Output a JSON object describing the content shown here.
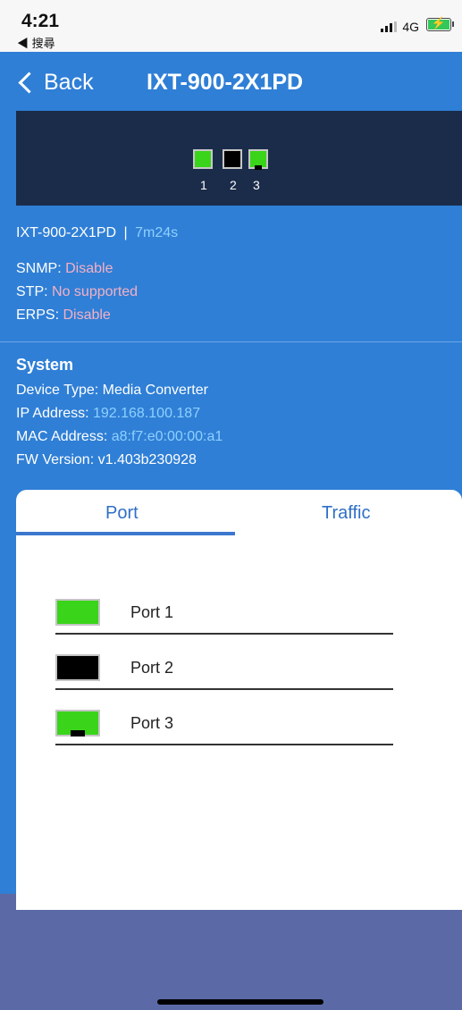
{
  "status_bar": {
    "time": "4:21",
    "back_app": "◀ 搜尋",
    "network": "4G"
  },
  "nav": {
    "back_label": "Back",
    "title": "IXT-900-2X1PD"
  },
  "device_panel": {
    "port_numbers": [
      "1",
      "2",
      "3"
    ]
  },
  "info": {
    "device_name": "IXT-900-2X1PD",
    "separator": "|",
    "uptime": "7m24s",
    "snmp_label": "SNMP:",
    "snmp_value": "Disable",
    "stp_label": "STP:",
    "stp_value": "No supported",
    "erps_label": "ERPS:",
    "erps_value": "Disable"
  },
  "system": {
    "title": "System",
    "device_type_label": "Device Type:",
    "device_type_value": "Media Converter",
    "ip_label": "IP Address:",
    "ip_value": "192.168.100.187",
    "mac_label": "MAC Address:",
    "mac_value": "a8:f7:e0:00:00:a1",
    "fw_label": "FW Version:",
    "fw_value": "v1.403b230928"
  },
  "tabs": {
    "port": "Port",
    "traffic": "Traffic",
    "active": "Port"
  },
  "ports": [
    {
      "label": "Port 1",
      "state": "link-up",
      "color": "#3ad41a"
    },
    {
      "label": "Port 2",
      "state": "link-down",
      "color": "#000000"
    },
    {
      "label": "Port 3",
      "state": "sfp-link-up",
      "color": "#3ad41a"
    }
  ],
  "colors": {
    "background_blue": "#2f7fd6",
    "device_panel": "#1a2c4a",
    "pink_value": "#f4b0c4",
    "light_blue_value": "#8ed0ff",
    "tab_accent": "#3c77cf",
    "bottom_bar": "#5b6aa6"
  }
}
